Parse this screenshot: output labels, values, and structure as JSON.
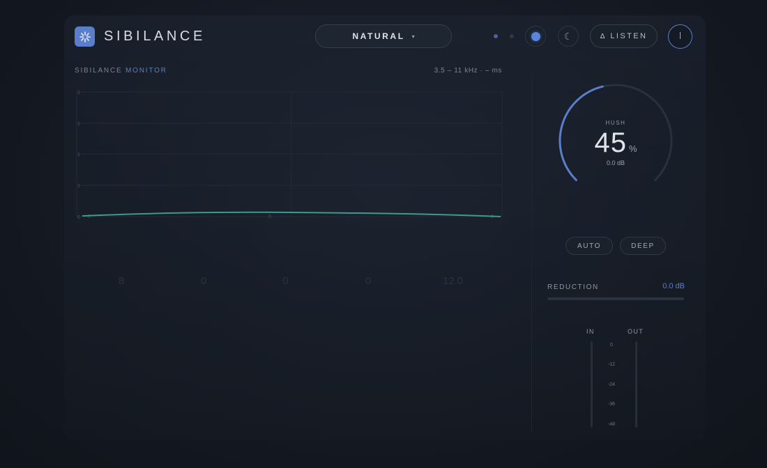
{
  "app": {
    "title": "SIBILANCE"
  },
  "header": {
    "preset": {
      "label": "NATURAL",
      "chevron": "⌄"
    },
    "listen_label": "LISTEN",
    "listen_icon": "Δ",
    "icons": {
      "theme_dark": "moon-icon",
      "theme_light": "sun-icon",
      "power": "power-icon",
      "logo": "pinwheel-logo-icon"
    }
  },
  "monitor": {
    "title_prefix": "SIBILANCE",
    "title_accent": "MONITOR",
    "range": "3.5 – 11 kHz  ·  – ms",
    "y_labels": [
      "1",
      "1",
      "1",
      "1",
      "0"
    ],
    "x_markers": [
      "0",
      "0",
      "0"
    ],
    "ghost_labels": [
      "8",
      "0",
      "0",
      "0",
      "12.0"
    ]
  },
  "hush": {
    "label": "HUSH",
    "value": "45",
    "unit": "%",
    "db": "0.0 dB",
    "level_fraction": 0.45
  },
  "modes": {
    "auto": "AUTO",
    "deep": "DEEP"
  },
  "reduction": {
    "label": "REDUCTION",
    "value": "0.0 dB"
  },
  "meters": {
    "in_label": "IN",
    "out_label": "OUT",
    "scale": [
      "0",
      "-12",
      "-24",
      "-36",
      "-48"
    ]
  },
  "colors": {
    "accent": "#5a7ec9",
    "curve": "#3d9a8e",
    "background": "#141922"
  }
}
